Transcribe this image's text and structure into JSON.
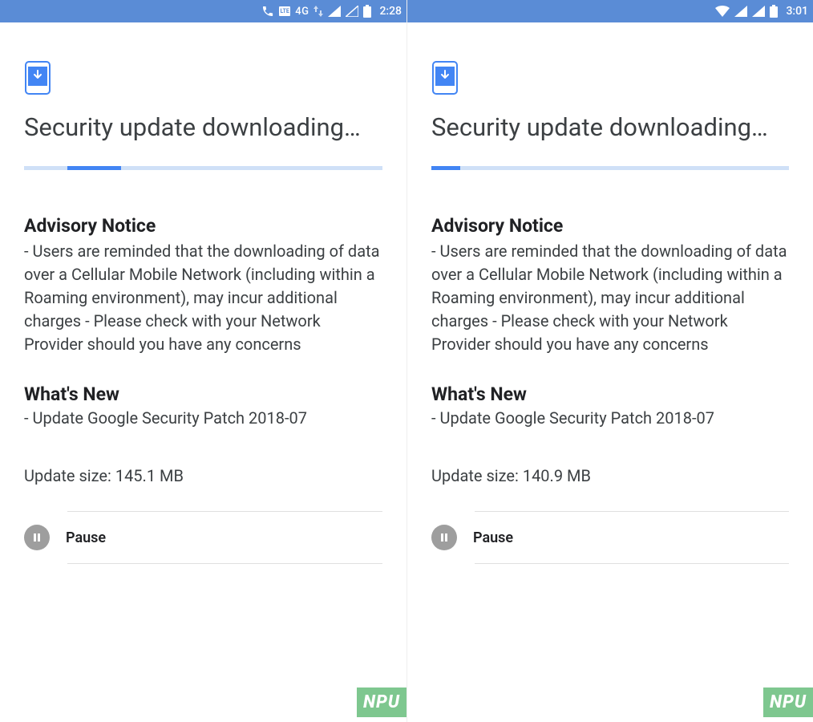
{
  "phones": [
    {
      "statusbar": {
        "lte_badge": "LTE",
        "net_text": "4G",
        "clock": "2:28",
        "layout": "lte"
      },
      "title": "Security update downloading…",
      "progress": {
        "left_pct": 12,
        "width_pct": 15
      },
      "advisory_title": "Advisory Notice",
      "advisory_text": "- Users are reminded that the downloading of data over a Cellular Mobile Network (including within a Roaming environment), may incur additional charges - Please check with your Network Provider should you have any concerns",
      "whatsnew_title": "What's New",
      "whatsnew_text": "- Update Google Security Patch 2018-07",
      "update_size": "Update size: 145.1 MB",
      "action_label": "Pause",
      "watermark": "NPU"
    },
    {
      "statusbar": {
        "clock": "3:01",
        "layout": "wifi"
      },
      "title": "Security update downloading…",
      "progress": {
        "left_pct": 0,
        "width_pct": 8
      },
      "advisory_title": "Advisory Notice",
      "advisory_text": "- Users are reminded that the downloading of data over a Cellular Mobile Network (including within a Roaming environment), may incur additional charges - Please check with your Network Provider should you have any concerns",
      "whatsnew_title": "What's New",
      "whatsnew_text": "- Update Google Security Patch 2018-07",
      "update_size": "Update size: 140.9 MB",
      "action_label": "Pause",
      "watermark": "NPU"
    }
  ]
}
